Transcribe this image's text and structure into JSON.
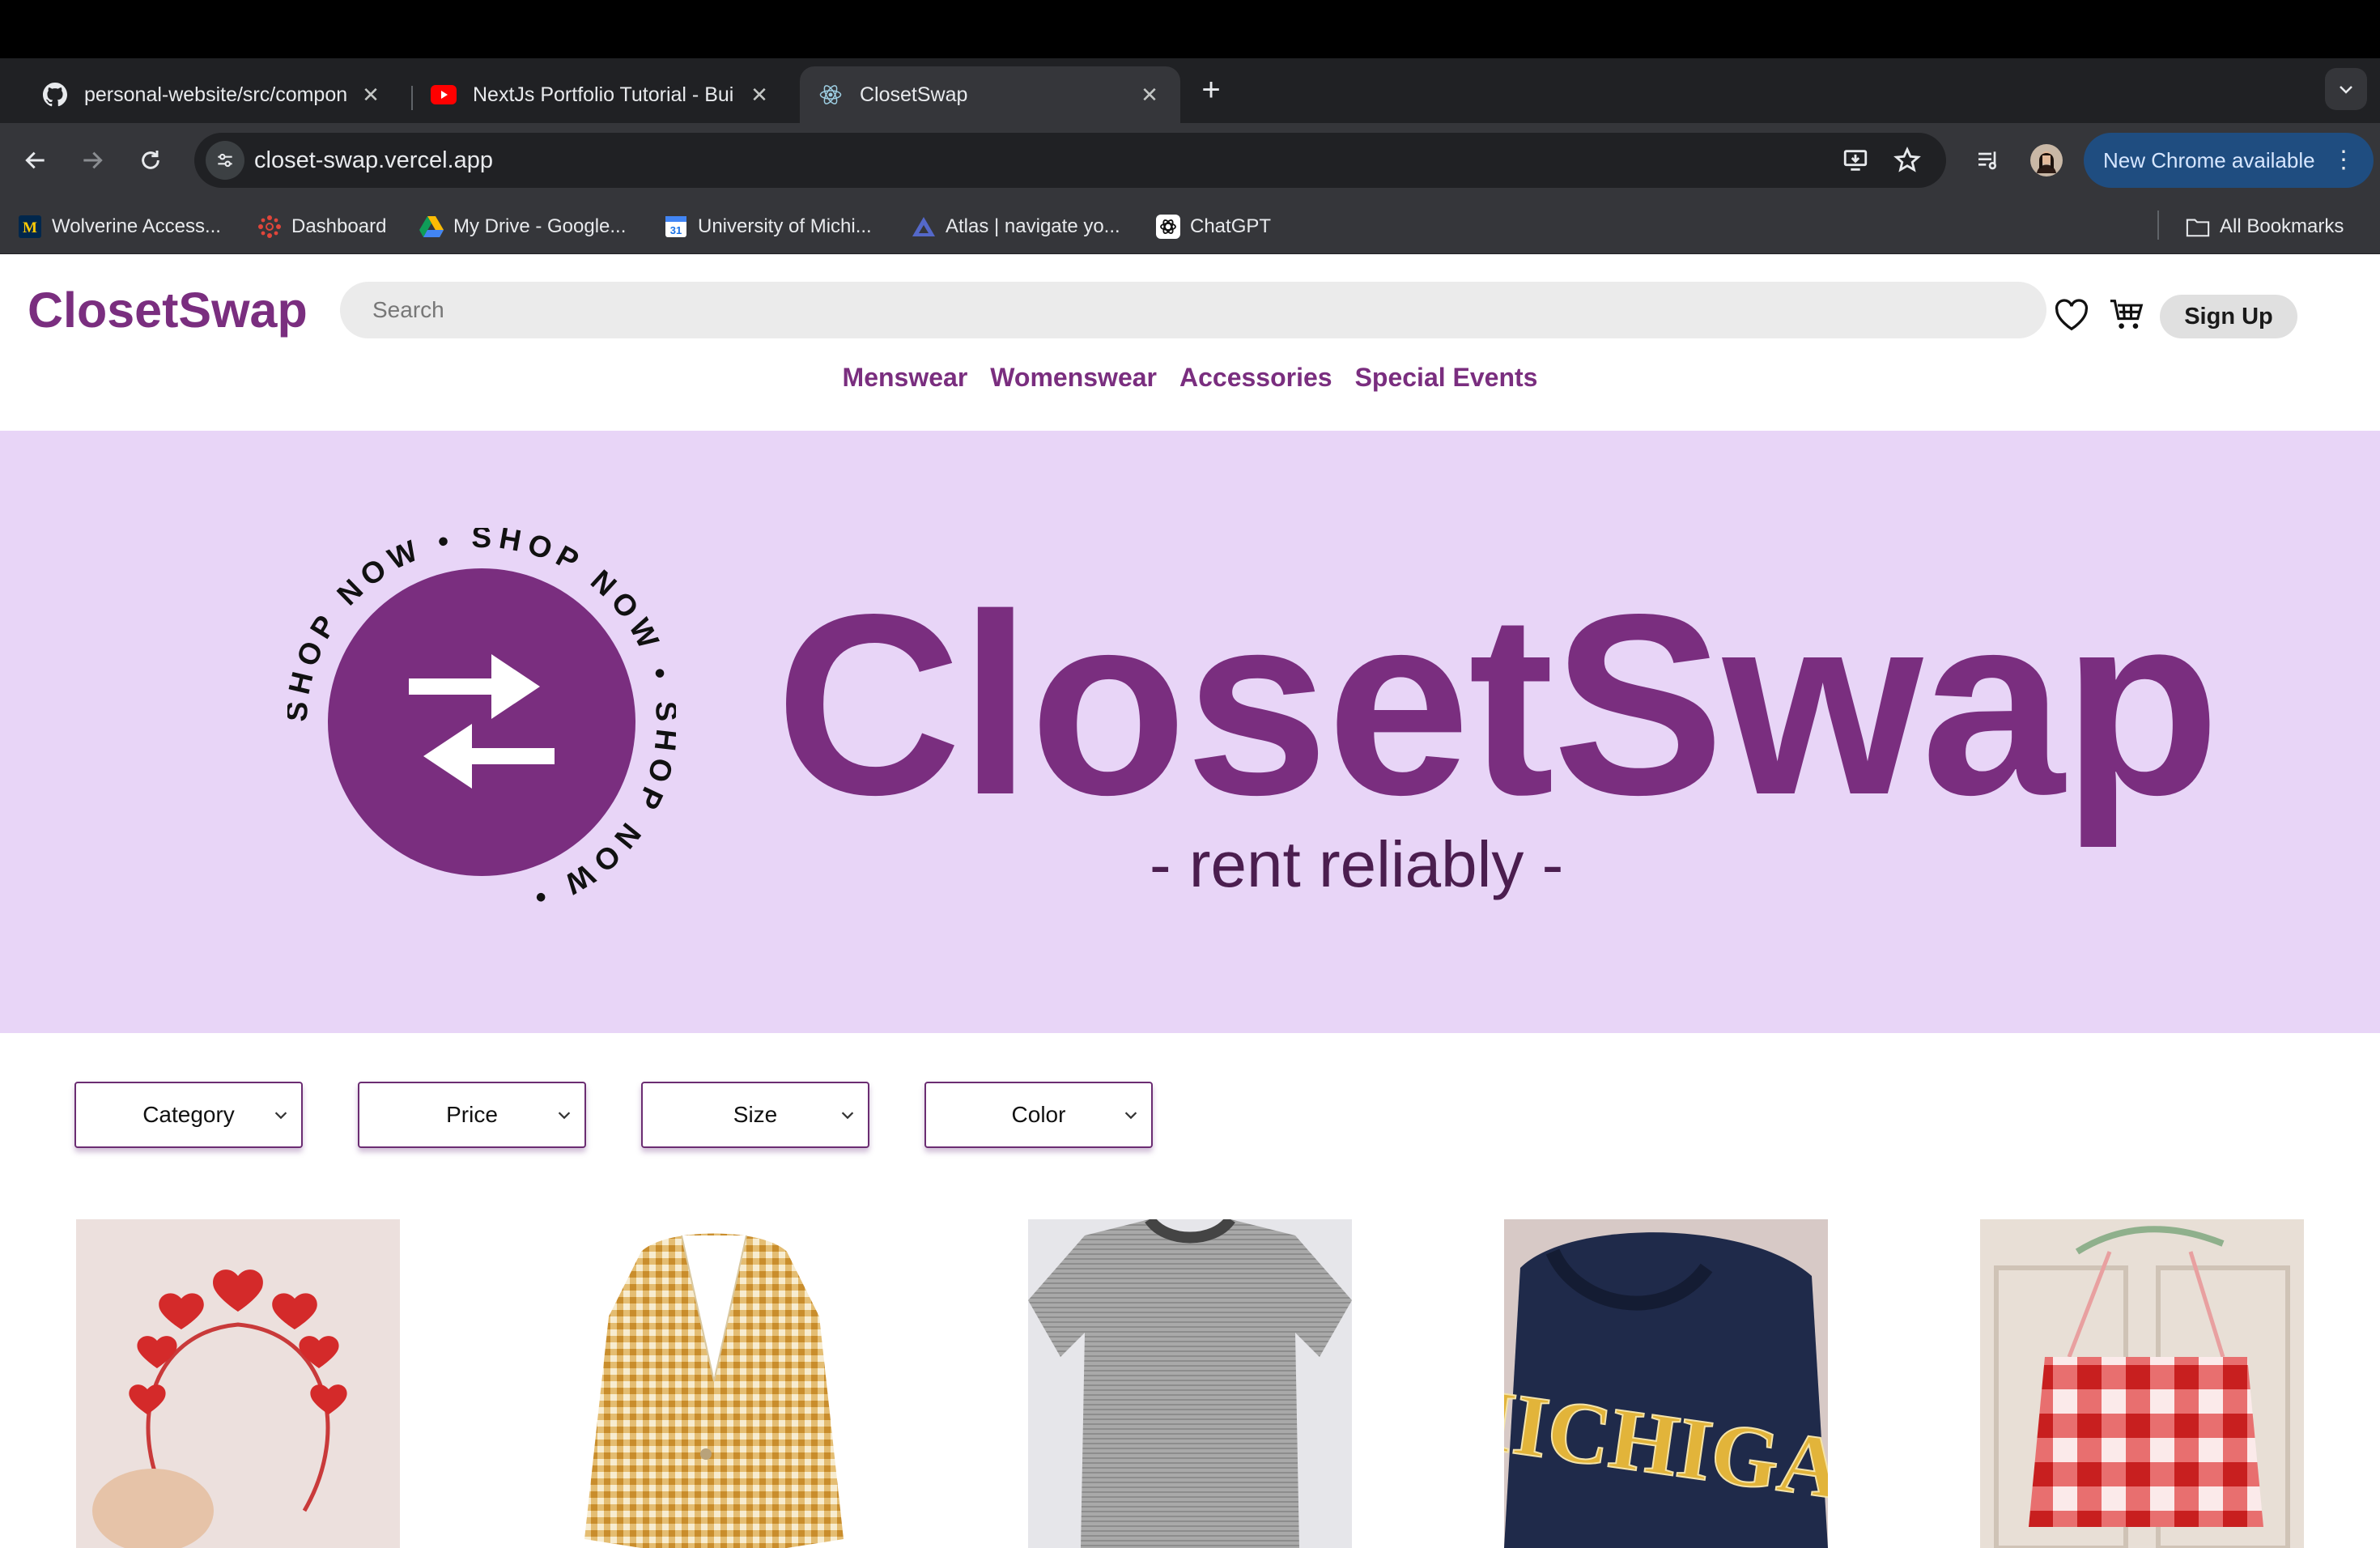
{
  "browser": {
    "tabs": [
      {
        "title": "personal-website/src/compon",
        "icon": "github-icon"
      },
      {
        "title": "NextJs Portfolio Tutorial - Bui",
        "icon": "youtube-icon"
      },
      {
        "title": "ClosetSwap",
        "icon": "react-icon",
        "active": true
      }
    ],
    "new_tab": "+",
    "url": "closet-swap.vercel.app",
    "update_label": "New Chrome available",
    "bookmarks": [
      {
        "label": "Wolverine Access...",
        "icon": "umich-m-icon"
      },
      {
        "label": "Dashboard",
        "icon": "dashboard-icon"
      },
      {
        "label": "My Drive - Google...",
        "icon": "google-drive-icon"
      },
      {
        "label": "University of Michi...",
        "icon": "calendar-icon"
      },
      {
        "label": "Atlas | navigate yo...",
        "icon": "atlas-icon"
      },
      {
        "label": "ChatGPT",
        "icon": "chatgpt-icon"
      }
    ],
    "all_bookmarks": "All Bookmarks"
  },
  "site": {
    "logo": "ClosetSwap",
    "search_placeholder": "Search",
    "signup": "Sign Up",
    "nav": [
      "Menswear",
      "Womenswear",
      "Accessories",
      "Special Events"
    ]
  },
  "hero": {
    "title": "ClosetSwap",
    "tagline": "-  rent reliably  -",
    "badge_ring_text": "SHOP NOW • SHOP NOW • SHOP NOW • "
  },
  "filters": [
    "Category",
    "Price",
    "Size",
    "Color"
  ],
  "products": [
    {
      "name": "red-heart-headband"
    },
    {
      "name": "yellow-gingham-blazer"
    },
    {
      "name": "gray-striped-tshirt"
    },
    {
      "name": "navy-michigan-hoodie"
    },
    {
      "name": "red-gingham-top"
    }
  ],
  "colors": {
    "brand": "#7a2e7f",
    "hero_bg": "#e8d5f7",
    "chrome_dark": "#202124",
    "chrome_mid": "#35363a"
  }
}
